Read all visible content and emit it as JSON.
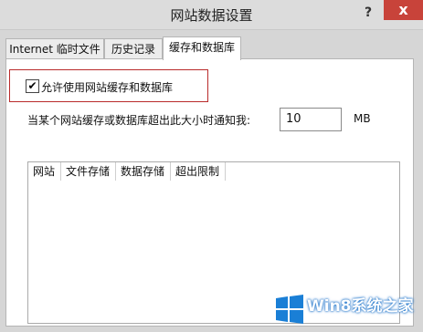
{
  "window": {
    "title": "网站数据设置",
    "help_label": "?",
    "close_label": "x"
  },
  "tabs": [
    {
      "label": "Internet 临时文件",
      "active": false
    },
    {
      "label": "历史记录",
      "active": false
    },
    {
      "label": "缓存和数据库",
      "active": true
    }
  ],
  "cache": {
    "allow_checked": true,
    "allow_check_glyph": "✔",
    "allow_label": "允许使用网站缓存和数据库",
    "notify_label": "当某个网站缓存或数据库超出此大小时通知我:",
    "size_value": "10",
    "size_unit": "MB"
  },
  "table": {
    "headers": [
      "网站",
      "文件存储",
      "数据存储",
      "超出限制"
    ],
    "rows": []
  },
  "watermark": {
    "text": "Win8系统之家",
    "brand_color": "#1a7fd6"
  }
}
